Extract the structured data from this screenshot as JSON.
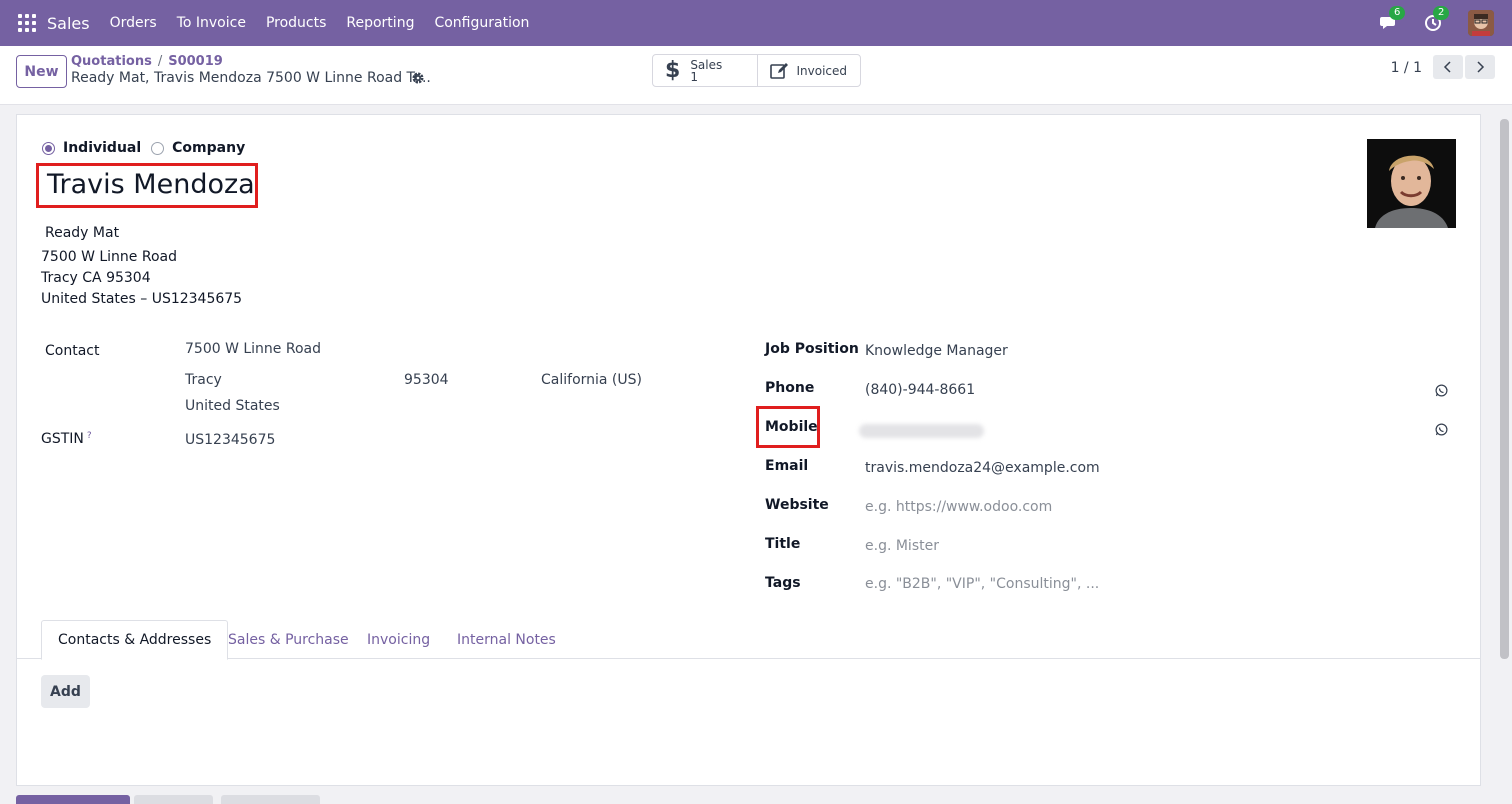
{
  "navbar": {
    "brand": "Sales",
    "menu": [
      "Orders",
      "To Invoice",
      "Products",
      "Reporting",
      "Configuration"
    ],
    "messages_count": "6",
    "activities_count": "2",
    "accent": "#7561a2"
  },
  "control_panel": {
    "new_label": "New",
    "breadcrumb_parent": "Quotations",
    "breadcrumb_current": "S00019",
    "record_title": "Ready Mat, Travis Mendoza 7500 W Linne Road Tr...",
    "smart_sales_label": "Sales",
    "smart_sales_count": "1",
    "smart_invoiced_label": "Invoiced",
    "pager": "1 / 1"
  },
  "form": {
    "type_individual": "Individual",
    "type_company": "Company",
    "name": "Travis Mendoza",
    "company": "Ready Mat",
    "address_line1": "7500 W Linne Road",
    "address_line2": "Tracy CA 95304",
    "address_line3": "United States – US12345675",
    "contact_label": "Contact",
    "street": "7500 W Linne Road",
    "city": "Tracy",
    "zip": "95304",
    "state": "California (US)",
    "country": "United States",
    "gstin_label": "GSTIN",
    "gstin_help": "?",
    "gstin": "US12345675",
    "job_position_label": "Job Position",
    "job_position": "Knowledge Manager",
    "phone_label": "Phone",
    "phone": "(840)-944-8661",
    "mobile_label": "Mobile",
    "email_label": "Email",
    "email": "travis.mendoza24@example.com",
    "website_label": "Website",
    "website_placeholder": "e.g. https://www.odoo.com",
    "title_label": "Title",
    "title_placeholder": "e.g. Mister",
    "tags_label": "Tags",
    "tags_placeholder": "e.g. \"B2B\", \"VIP\", \"Consulting\", ..."
  },
  "tabs": [
    "Contacts & Addresses",
    "Sales & Purchase",
    "Invoicing",
    "Internal Notes"
  ],
  "add_label": "Add"
}
